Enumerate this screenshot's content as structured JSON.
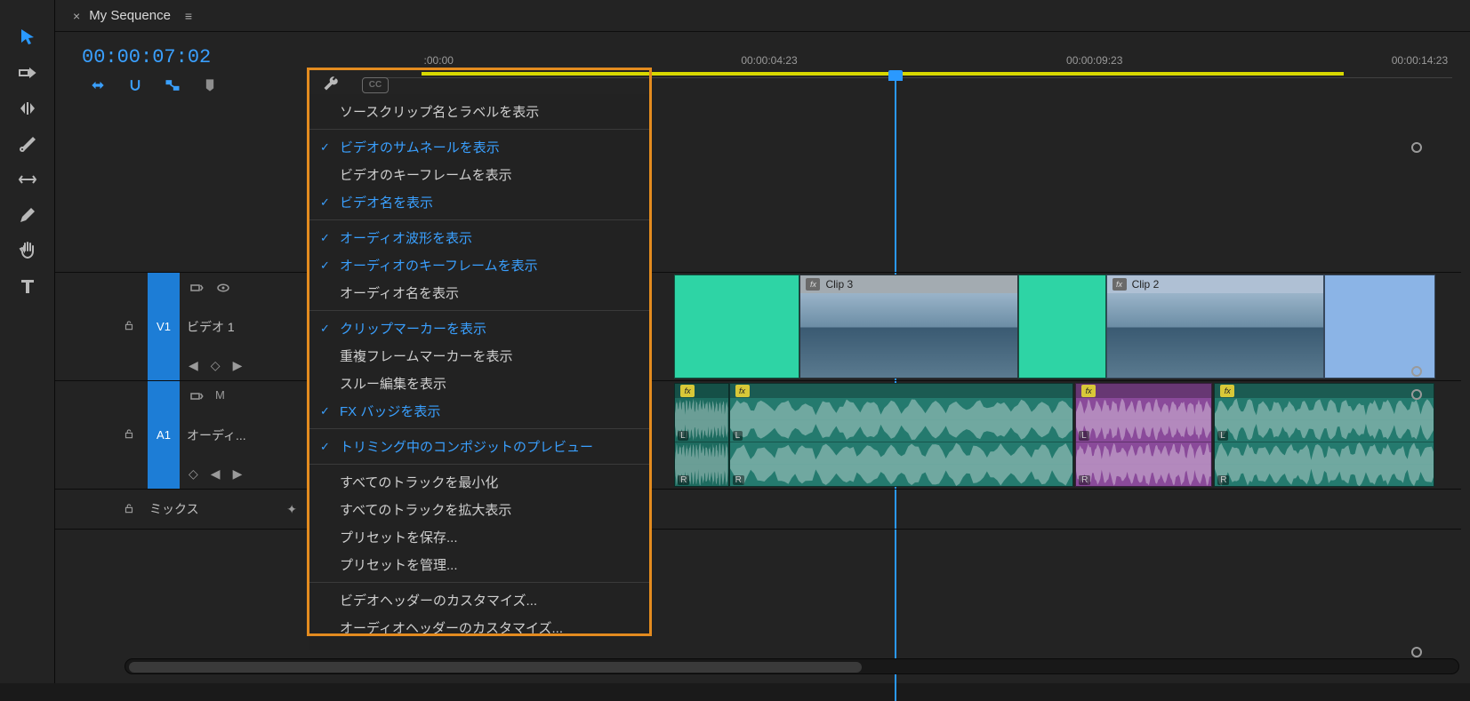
{
  "sequence": {
    "name": "My Sequence"
  },
  "timecode": "00:00:07:02",
  "ruler": {
    "ticks": [
      {
        "pos_pct": 6.5,
        "label": ":00:00"
      },
      {
        "pos_pct": 37,
        "label": "00:00:04:23"
      },
      {
        "pos_pct": 67,
        "label": "00:00:09:23"
      },
      {
        "pos_pct": 97,
        "label": "00:00:14:23"
      }
    ],
    "playhead_pct": 48
  },
  "tracks": {
    "v1": {
      "toggle": "V1",
      "name": "ビデオ 1"
    },
    "a1": {
      "toggle": "A1",
      "name": "オーディ..."
    },
    "mix": {
      "label": "ミックス"
    }
  },
  "clips": {
    "video": [
      {
        "id": "vcolor1",
        "left_pct": 28,
        "width_pct": 11.5,
        "color": "#2ed4a5",
        "label": ""
      },
      {
        "id": "clip3",
        "left_pct": 39.5,
        "width_pct": 20,
        "color": "#6c7f90",
        "label": "Clip 3",
        "thumb": true
      },
      {
        "id": "vcolor2",
        "left_pct": 59.5,
        "width_pct": 8,
        "color": "#2ed4a5",
        "label": ""
      },
      {
        "id": "clip2",
        "left_pct": 67.5,
        "width_pct": 20,
        "color": "#8bb4e6",
        "label": "Clip 2",
        "thumb": true
      },
      {
        "id": "vcolor3",
        "left_pct": 87.5,
        "width_pct": 10.1,
        "color": "#8bb4e6",
        "label": ""
      }
    ],
    "audio": [
      {
        "id": "ateal1",
        "left_pct": 28,
        "width_pct": 5,
        "color": "#1d6b5f"
      },
      {
        "id": "ateal2",
        "left_pct": 33,
        "width_pct": 31.5,
        "color": "#247a6e"
      },
      {
        "id": "apurp",
        "left_pct": 64.7,
        "width_pct": 12.5,
        "color": "#8a4a9a"
      },
      {
        "id": "ateal3",
        "left_pct": 77.4,
        "width_pct": 20.2,
        "color": "#247a6e"
      }
    ]
  },
  "badges": {
    "fx": "fx",
    "L": "L",
    "R": "R",
    "M": "M"
  },
  "cc_label": "CC",
  "dropdown": {
    "items": [
      {
        "label": "ソースクリップ名とラベルを表示",
        "checked": false,
        "sep_after": true
      },
      {
        "label": "ビデオのサムネールを表示",
        "checked": true
      },
      {
        "label": "ビデオのキーフレームを表示",
        "checked": false
      },
      {
        "label": "ビデオ名を表示",
        "checked": true,
        "sep_after": true
      },
      {
        "label": "オーディオ波形を表示",
        "checked": true
      },
      {
        "label": "オーディオのキーフレームを表示",
        "checked": true
      },
      {
        "label": "オーディオ名を表示",
        "checked": false,
        "sep_after": true
      },
      {
        "label": "クリップマーカーを表示",
        "checked": true
      },
      {
        "label": "重複フレームマーカーを表示",
        "checked": false
      },
      {
        "label": "スルー編集を表示",
        "checked": false
      },
      {
        "label": "FX バッジを表示",
        "checked": true,
        "sep_after": true
      },
      {
        "label": "トリミング中のコンポジットのプレビュー",
        "checked": true,
        "sep_after": true
      },
      {
        "label": "すべてのトラックを最小化",
        "checked": false
      },
      {
        "label": "すべてのトラックを拡大表示",
        "checked": false
      },
      {
        "label": "プリセットを保存...",
        "checked": false
      },
      {
        "label": "プリセットを管理...",
        "checked": false,
        "sep_after": true
      },
      {
        "label": "ビデオヘッダーのカスタマイズ...",
        "checked": false
      },
      {
        "label": "オーディオヘッダーのカスタマイズ...",
        "checked": false
      }
    ]
  }
}
